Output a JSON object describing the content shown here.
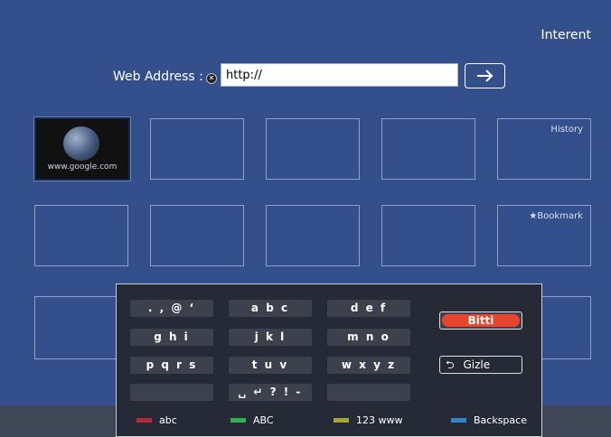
{
  "header": {
    "title": "Interent"
  },
  "address_bar": {
    "label": "Web Address :",
    "value": "http://",
    "clear_icon": "clear-icon",
    "go_icon": "arrow-right-icon"
  },
  "tiles": {
    "thumbnail_caption": "www.google.com",
    "history_label": "History",
    "bookmark_label": "Bookmark"
  },
  "keyboard": {
    "keys": [
      [
        ". , @ ‘",
        "a b c",
        "d e f"
      ],
      [
        "g h i",
        "j k l",
        "m n o"
      ],
      [
        "p q r s",
        "t u v",
        "w x y z"
      ],
      [
        "",
        "␣ ↵ ? ! -",
        ""
      ]
    ],
    "done_label": "Bitti",
    "hide_label": "Gizle",
    "hide_icon": "return-icon"
  },
  "legend": [
    {
      "label": "abc",
      "color": "#b22a3c"
    },
    {
      "label": "ABC",
      "color": "#2fb24b"
    },
    {
      "label": "123 www",
      "color": "#a8a43a"
    },
    {
      "label": "Backspace",
      "color": "#2e86c8"
    }
  ],
  "colors": {
    "background": "#34508c",
    "keyboard_bg": "#262a36",
    "done_button": "#e8452c"
  }
}
